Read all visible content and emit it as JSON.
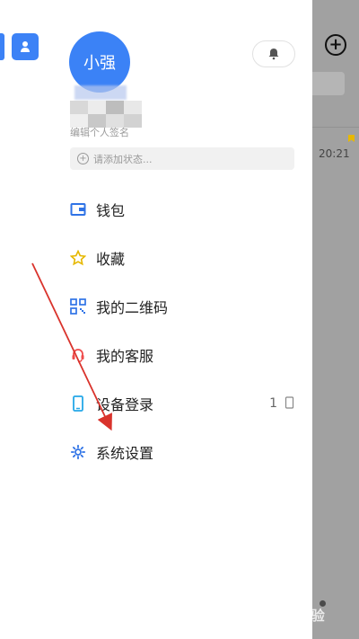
{
  "profile": {
    "name": "小强",
    "signature": "编辑个人签名"
  },
  "status": {
    "placeholder": "请添加状态..."
  },
  "menu": {
    "wallet": "钱包",
    "favorites": "收藏",
    "qr_code": "我的二维码",
    "customer_service": "我的客服",
    "device_login": "设备登录",
    "device_count": "1",
    "settings": "系统设置"
  },
  "chat": {
    "time": "20:21"
  },
  "watermark": "Bai经验",
  "colors": {
    "brand_blue": "#3b82f6",
    "arrow_red": "#d9332c",
    "yellow": "#e6b800"
  }
}
